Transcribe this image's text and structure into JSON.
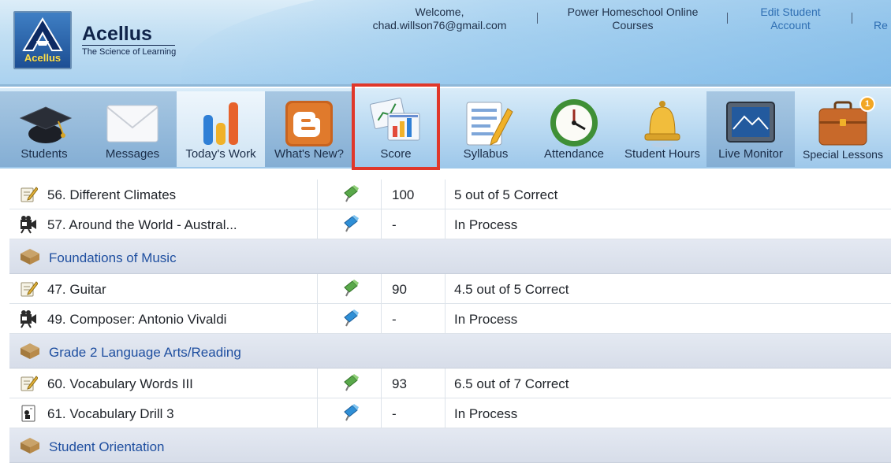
{
  "header": {
    "brand_name": "Acellus",
    "brand_tagline": "The Science of Learning",
    "logo_word": "Acellus",
    "welcome_line1": "Welcome,",
    "welcome_line2": "chad.willson76@gmail.com",
    "school_line1": "Power Homeschool Online",
    "school_line2": "Courses",
    "edit_line1": "Edit Student",
    "edit_line2": "Account",
    "cut_link": "Re"
  },
  "toolbar": {
    "items": [
      {
        "label": "Students",
        "icon": "graduation-cap-icon"
      },
      {
        "label": "Messages",
        "icon": "envelope-icon"
      },
      {
        "label": "Today's Work",
        "icon": "bar-chart-icon"
      },
      {
        "label": "What's New?",
        "icon": "blogger-icon"
      },
      {
        "label": "Score",
        "icon": "score-charts-icon"
      },
      {
        "label": "Syllabus",
        "icon": "syllabus-icon"
      },
      {
        "label": "Attendance",
        "icon": "clock-icon"
      },
      {
        "label": "Student Hours",
        "icon": "bell-icon"
      },
      {
        "label": "Live Monitor",
        "icon": "monitor-icon"
      },
      {
        "label": "Special Lessons",
        "icon": "briefcase-icon"
      }
    ],
    "special_badge": "1",
    "highlight_color": "#e0372a"
  },
  "table": {
    "rows": [
      {
        "kind": "lesson",
        "name": "56. Different Climates",
        "score": "100",
        "status": "5 out of 5 Correct",
        "icon": "quiz-icon",
        "flag": "green"
      },
      {
        "kind": "lesson",
        "name": "57. Around the World - Austral...",
        "score": "-",
        "status": "In Process",
        "icon": "video-icon",
        "flag": "blue"
      },
      {
        "kind": "group",
        "name": "Foundations of Music"
      },
      {
        "kind": "lesson",
        "name": "47. Guitar",
        "score": "90",
        "status": "4.5 out of 5 Correct",
        "icon": "quiz-icon",
        "flag": "green"
      },
      {
        "kind": "lesson",
        "name": "49. Composer: Antonio Vivaldi",
        "score": "-",
        "status": "In Process",
        "icon": "video-icon",
        "flag": "blue"
      },
      {
        "kind": "group",
        "name": "Grade 2 Language Arts/Reading"
      },
      {
        "kind": "lesson",
        "name": "60. Vocabulary Words III",
        "score": "93",
        "status": "6.5 out of 7 Correct",
        "icon": "quiz-icon",
        "flag": "green"
      },
      {
        "kind": "lesson",
        "name": "61. Vocabulary Drill 3",
        "score": "-",
        "status": "In Process",
        "icon": "drill-icon",
        "flag": "blue"
      },
      {
        "kind": "group",
        "name": "Student Orientation"
      }
    ]
  }
}
